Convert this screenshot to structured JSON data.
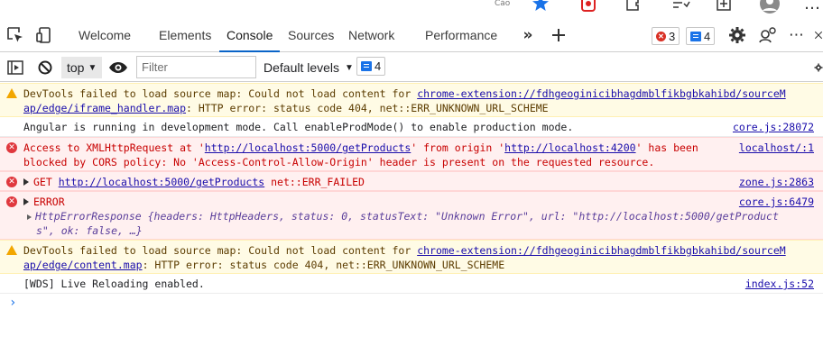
{
  "browser": {
    "profile_text": "Cảo"
  },
  "tabs": [
    {
      "label": "Welcome"
    },
    {
      "label": "Elements"
    },
    {
      "label": "Console",
      "active": true
    },
    {
      "label": "Sources"
    },
    {
      "label": "Network"
    },
    {
      "label": "Performance"
    }
  ],
  "badges": {
    "errors": "3",
    "messages": "4"
  },
  "toolbar": {
    "context": "top",
    "filter_placeholder": "Filter",
    "levels": "Default levels",
    "issues": "4"
  },
  "messages": [
    {
      "level": "warning",
      "line1": "DevTools failed to load source map: Could not load content for ",
      "link": "chrome-extension://fdhgeoginicibhagdmblfikbgbkahibd/sourceM",
      "link2": "ap/edge/iframe_handler.map",
      "tail": ": HTTP error: status code 404, net::ERR_UNKNOWN_URL_SCHEME"
    },
    {
      "level": "info",
      "text": "Angular is running in development mode. Call enableProdMode() to enable production mode.",
      "source": "core.js:28072"
    },
    {
      "level": "error",
      "p1": "Access to XMLHttpRequest at '",
      "u1": "http://localhost:5000/getProducts",
      "p2": "' from origin '",
      "u2": "http://localhost:4200",
      "p3": "' has been",
      "line2": "blocked by CORS policy: No 'Access-Control-Allow-Origin' header is present on the requested resource.",
      "source": "localhost/:1"
    },
    {
      "level": "error",
      "method": "GET ",
      "url": "http://localhost:5000/getProducts",
      "tail": " net::ERR_FAILED",
      "source": "zone.js:2863"
    },
    {
      "level": "error",
      "title": "ERROR",
      "detail1": "HttpErrorResponse {headers: HttpHeaders, status: 0, statusText: \"Unknown Error\", url: \"http://localhost:5000/getProduct",
      "detail2": "s\", ok: false, …}",
      "source": "core.js:6479"
    },
    {
      "level": "warning",
      "line1": "DevTools failed to load source map: Could not load content for ",
      "link": "chrome-extension://fdhgeoginicibhagdmblfikbgbkahibd/sourceM",
      "link2": "ap/edge/content.map",
      "tail": ": HTTP error: status code 404, net::ERR_UNKNOWN_URL_SCHEME"
    },
    {
      "level": "info",
      "text": "[WDS] Live Reloading enabled.",
      "source": "index.js:52"
    }
  ],
  "colors": {
    "accent": "#0a64c8",
    "error": "#c80000",
    "warning_bg": "#fffbe5",
    "error_bg": "#fff0f0",
    "link": "#1a0dab"
  }
}
